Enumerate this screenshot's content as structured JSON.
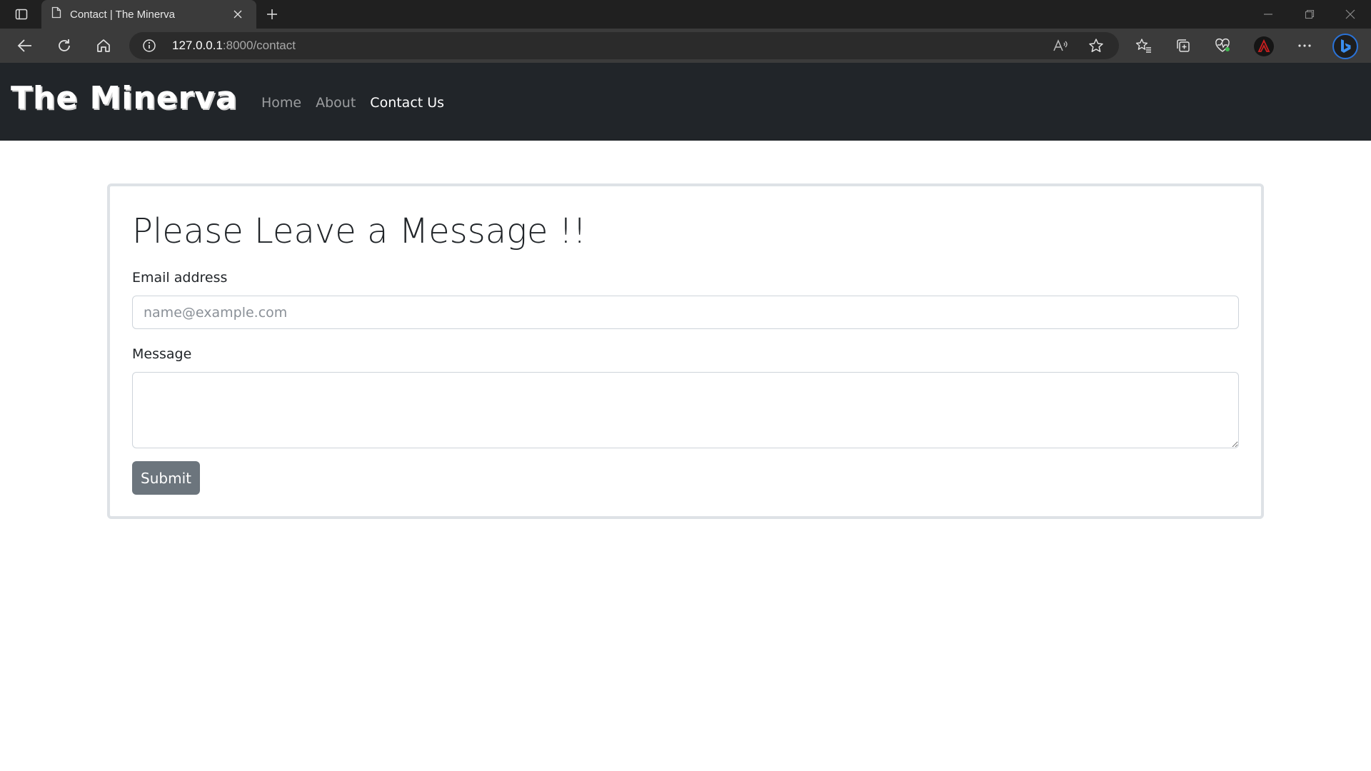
{
  "browser": {
    "tab_title": "Contact | The Minerva",
    "url_host": "127.0.0.1",
    "url_rest": ":8000/contact",
    "icons": [
      "tab-actions-icon",
      "page-icon",
      "close-icon",
      "plus-icon",
      "minimize-icon",
      "restore-icon",
      "window-close-icon",
      "back-icon",
      "refresh-icon",
      "home-icon",
      "info-icon",
      "read-aloud-icon",
      "favorite-star-icon",
      "favorites-icon",
      "collections-icon",
      "browser-essentials-icon",
      "profile-avatar-icon",
      "more-icon",
      "bing-icon"
    ]
  },
  "navbar": {
    "brand": "The Minerva",
    "links": [
      {
        "label": "Home",
        "active": false
      },
      {
        "label": "About",
        "active": false
      },
      {
        "label": "Contact Us",
        "active": true
      }
    ]
  },
  "form": {
    "heading": "Please Leave a Message !!",
    "email_label": "Email address",
    "email_placeholder": "name@example.com",
    "email_value": "",
    "message_label": "Message",
    "message_value": "",
    "submit_label": "Submit"
  },
  "colors": {
    "navbar_bg": "#212529",
    "button_bg": "#6c757d",
    "card_border": "#dee2e6"
  }
}
